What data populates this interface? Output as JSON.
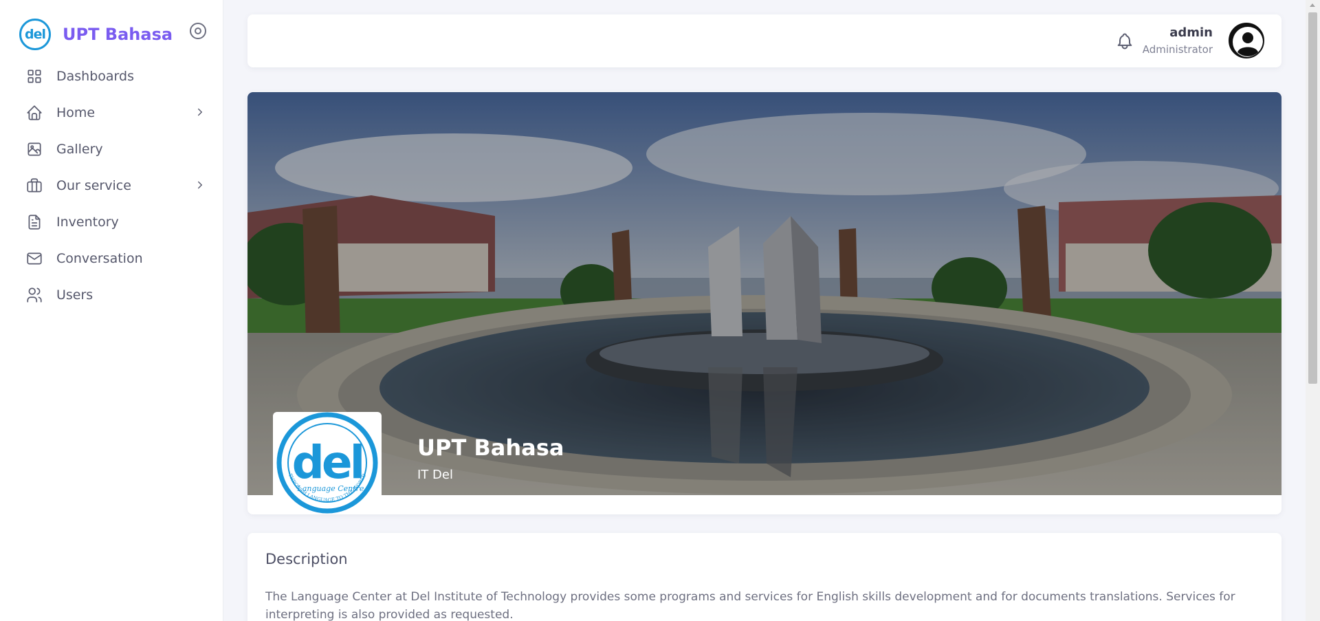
{
  "brand": {
    "logo_text": "del",
    "name": "UPT Bahasa"
  },
  "sidebar": {
    "items": [
      {
        "label": "Dashboards",
        "icon": "grid-icon",
        "has_submenu": false
      },
      {
        "label": "Home",
        "icon": "home-icon",
        "has_submenu": true
      },
      {
        "label": "Gallery",
        "icon": "image-icon",
        "has_submenu": false
      },
      {
        "label": "Our service",
        "icon": "briefcase-icon",
        "has_submenu": true
      },
      {
        "label": "Inventory",
        "icon": "file-text-icon",
        "has_submenu": false
      },
      {
        "label": "Conversation",
        "icon": "mail-icon",
        "has_submenu": false
      },
      {
        "label": "Users",
        "icon": "users-icon",
        "has_submenu": false
      }
    ]
  },
  "topbar": {
    "user_name": "admin",
    "user_role": "Administrator"
  },
  "profile": {
    "title": "UPT Bahasa",
    "subtitle": "IT Del",
    "logo_text": "del",
    "logo_tagline": "Language Centre",
    "logo_ring_text": "THROUGH LANGUAGE TO THE WORLD"
  },
  "description": {
    "title": "Description",
    "text": "The Language Center at Del Institute of Technology provides some programs and services for English skills development and for documents translations. Services for interpreting is also provided as requested."
  },
  "colors": {
    "accent": "#7a5cf0",
    "logo_blue": "#1b97d9",
    "background": "#f4f5fa"
  }
}
